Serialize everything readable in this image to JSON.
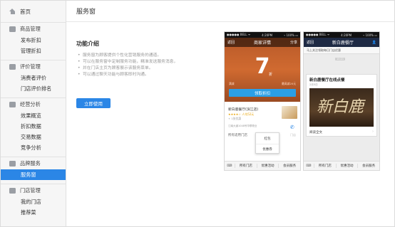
{
  "sidebar": {
    "home": "首页",
    "sections": [
      {
        "title": "商品管理",
        "items": [
          "发布折扣",
          "管理折扣"
        ]
      },
      {
        "title": "评价管理",
        "items": [
          "消费者评价",
          "门店评价排名"
        ]
      },
      {
        "title": "经营分析",
        "items": [
          "效果概览",
          "折扣数据",
          "交易数据",
          "竞争分析"
        ]
      },
      {
        "title": "品牌服务",
        "items": [
          "服务窗"
        ]
      },
      {
        "title": "门店管理",
        "items": [
          "我的门店",
          "推荐菜"
        ]
      }
    ],
    "active_item": "服务窗"
  },
  "header": {
    "title": "服务窗"
  },
  "main": {
    "section_title": "功能介绍",
    "bullets": [
      "服务窗为顾客提供个性化营销服务的通道。",
      "可以在服务窗中定制服务功能，精准发送服务消息，",
      "并在门店主页为顾客展示该服务菜单。",
      "可以通过聊天功能与顾客即时沟通。"
    ],
    "use_button": "立即使用"
  },
  "phone1": {
    "status_left": "●●●●● BELL ᯤ",
    "status_time": "4:20PM",
    "status_right": "⌁ 100% ▭",
    "back": "返回",
    "title": "商家详情",
    "share": "分享",
    "discount": "7",
    "discount_unit": "折",
    "meta_left": "满减",
    "meta_right": "最高减20元",
    "coupon_button": "领取折扣",
    "shop_name": "新白鹿餐厅(滨江店)",
    "shop_rating": "★★★★☆ 人均52元",
    "shop_tag": "+ 1张优惠",
    "address": "江南大道1048号华联物业",
    "all_label": "所有适用门店",
    "more_label": "门店",
    "popup_items": [
      "红包",
      "优惠券"
    ],
    "tabs": [
      "所有门店",
      "优惠活动",
      "会员服务"
    ]
  },
  "phone2": {
    "status_left": "●●●●● BELL ᯤ",
    "status_time": "4:20PM",
    "status_right": "⌁ 100% ▭",
    "back": "返回",
    "title": "新白鹿餐厅",
    "join_text": "马上关注领取每日门店优惠",
    "time": "10:21",
    "card_title": "新白鹿餐厅在线点餐",
    "card_date": "2月5日",
    "card_image_text": "新白鹿",
    "card_read": "阅读全文",
    "tabs": [
      "所有门店",
      "优惠活动",
      "会员服务"
    ]
  },
  "colors": {
    "accent": "#2b86e6",
    "sidebar_bg": "#f6f6f6",
    "hero": "#c8622c"
  }
}
